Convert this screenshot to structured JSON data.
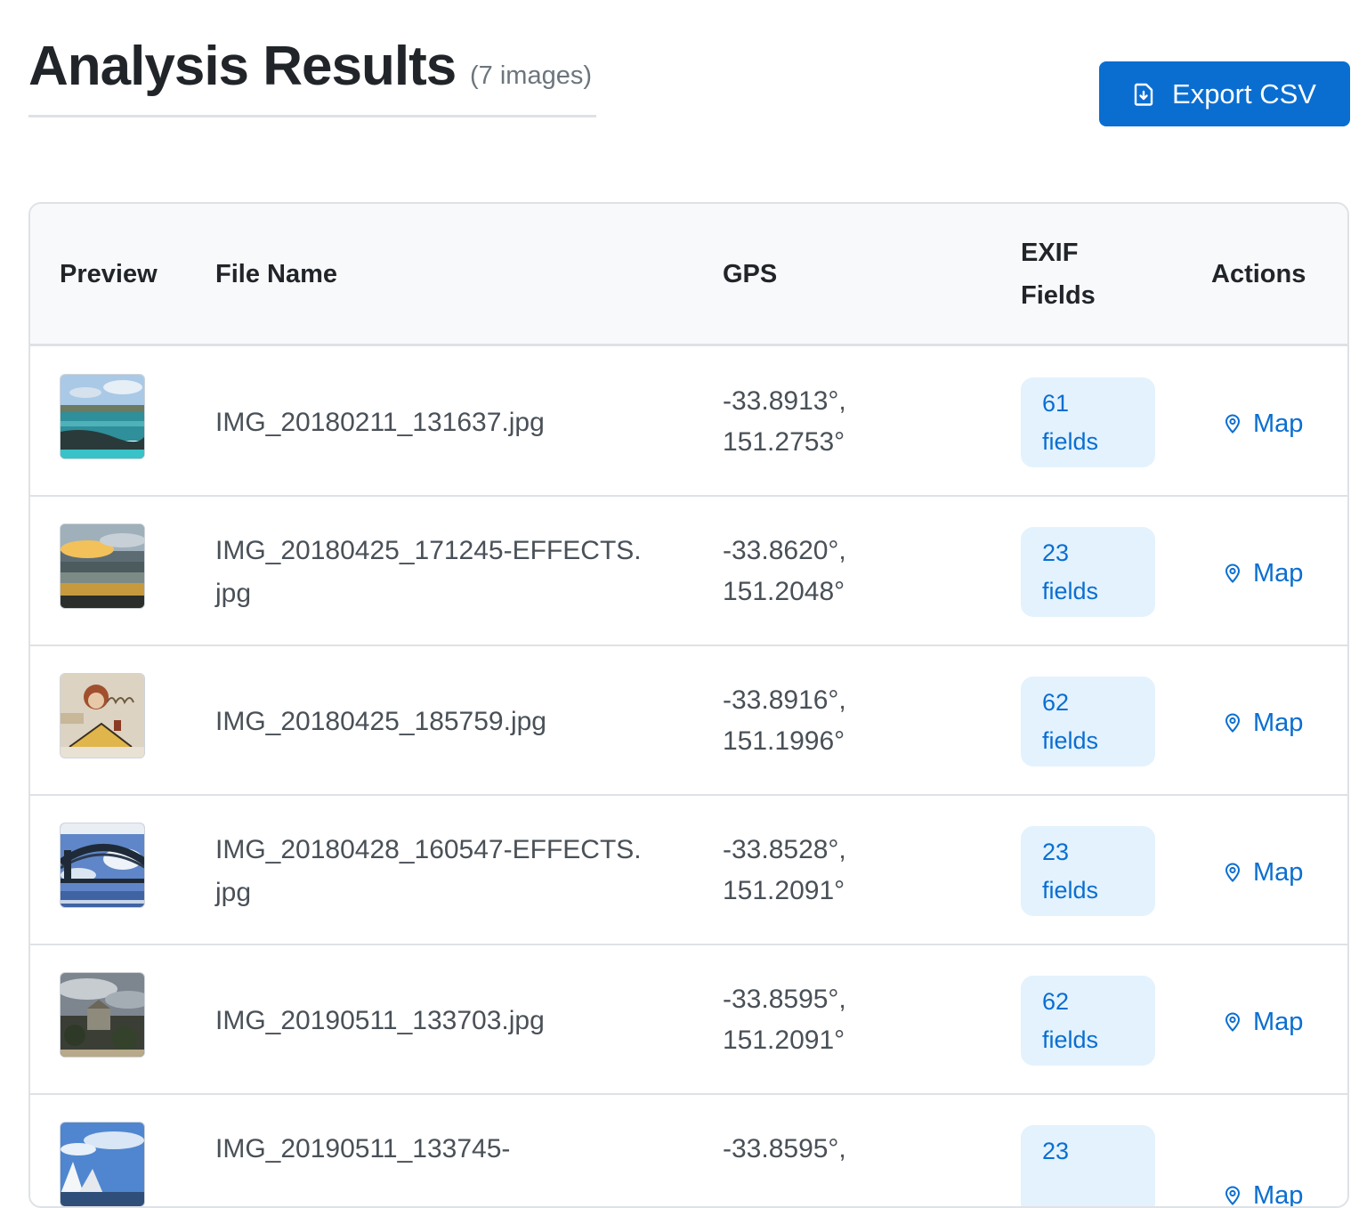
{
  "header": {
    "title": "Analysis Results",
    "count": "(7 images)"
  },
  "toolbar": {
    "export_label": "Export CSV",
    "export_icon": "file-download-icon"
  },
  "table": {
    "columns": {
      "preview": "Preview",
      "file_name": "File Name",
      "gps": "GPS",
      "exif_line1": "EXIF",
      "exif_line2": "Fields",
      "actions": "Actions"
    },
    "rows": [
      {
        "file_name": "IMG_20180211_131637.jpg",
        "lat": "-33.8913°,",
        "lon": "151.2753°",
        "fields_count": "61",
        "fields_label": "fields",
        "action": "Map",
        "thumb": "coastal-pool-thumbnail"
      },
      {
        "file_name": "IMG_20180425_171245-EFFECTS.jpg",
        "lat": "-33.8620°,",
        "lon": "151.2048°",
        "fields_count": "23",
        "fields_label": "fields",
        "action": "Map",
        "thumb": "sunset-harbour-thumbnail"
      },
      {
        "file_name": "IMG_20180425_185759.jpg",
        "lat": "-33.8916°,",
        "lon": "151.1996°",
        "fields_count": "62",
        "fields_label": "fields",
        "action": "Map",
        "thumb": "street-art-thumbnail"
      },
      {
        "file_name": "IMG_20180428_160547-EFFECTS.jpg",
        "lat": "-33.8528°,",
        "lon": "151.2091°",
        "fields_count": "23",
        "fields_label": "fields",
        "action": "Map",
        "thumb": "harbour-bridge-thumbnail"
      },
      {
        "file_name": "IMG_20190511_133703.jpg",
        "lat": "-33.8595°,",
        "lon": "151.2091°",
        "fields_count": "62",
        "fields_label": "fields",
        "action": "Map",
        "thumb": "cloudy-city-thumbnail"
      },
      {
        "file_name": "IMG_20190511_133745-",
        "lat": "-33.8595°,",
        "lon": "",
        "fields_count": "23",
        "fields_label": "",
        "action": "Map",
        "thumb": "opera-house-thumbnail"
      }
    ]
  },
  "colors": {
    "accent": "#0a6ed1",
    "badge_bg": "#e3f2fd",
    "header_bg": "#f8f9fa",
    "border": "#dee2e6"
  }
}
